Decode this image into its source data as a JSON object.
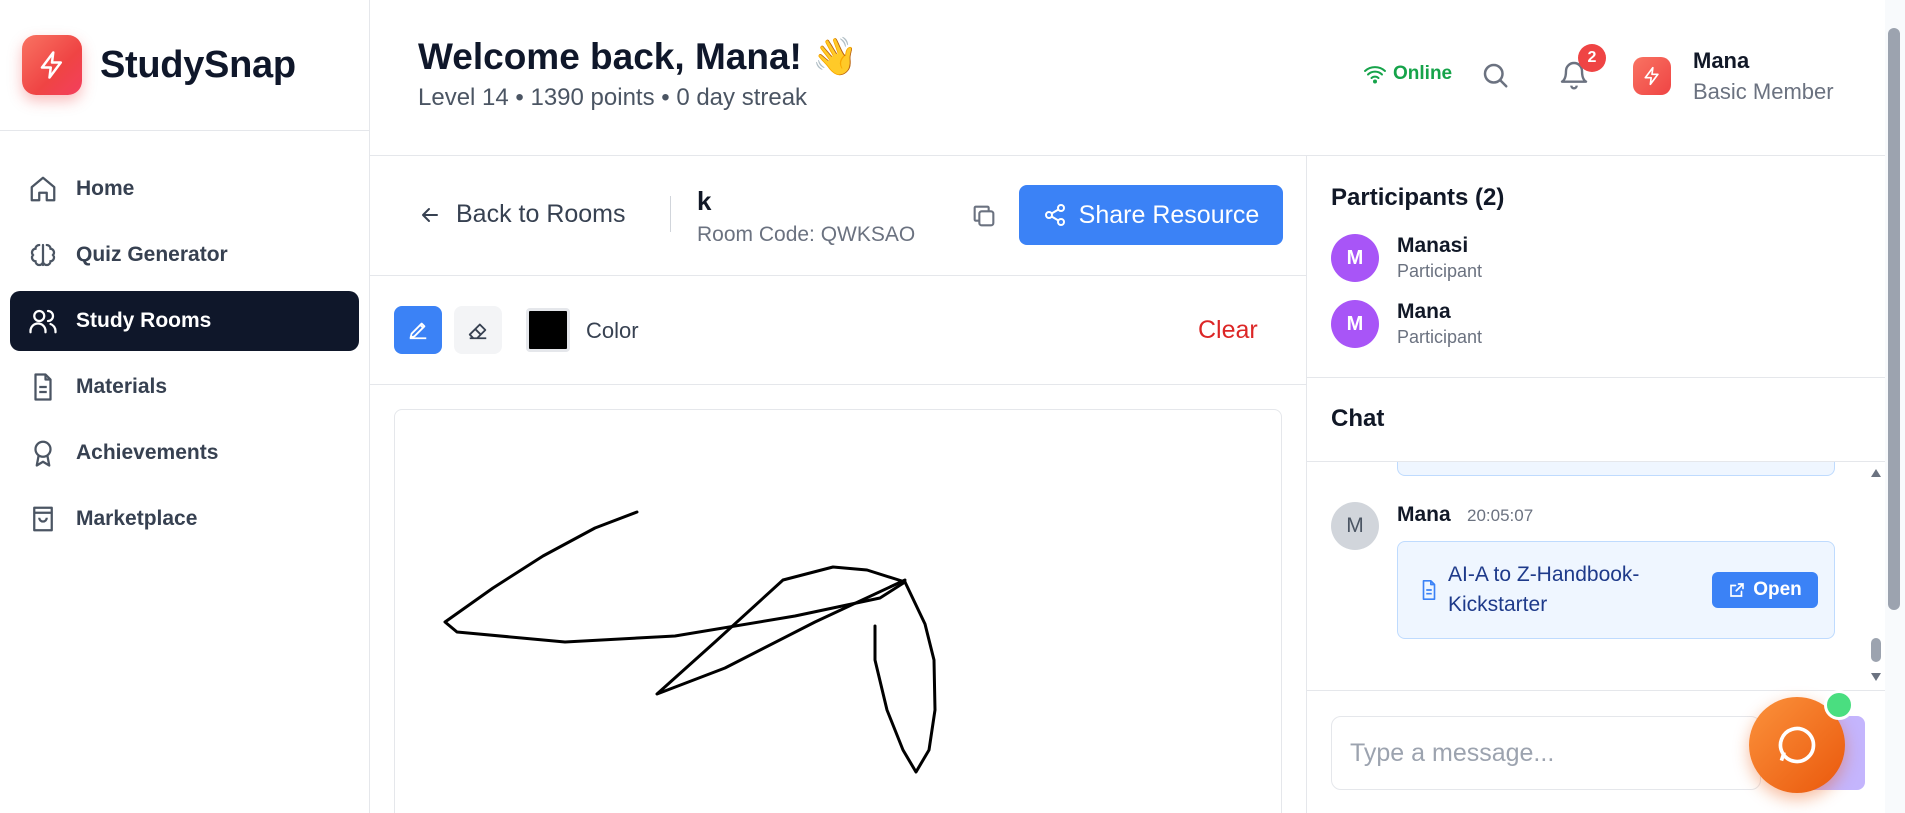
{
  "brand": {
    "name": "StudySnap",
    "logo_icon": "lightning-icon"
  },
  "sidebar": {
    "items": [
      {
        "label": "Home",
        "icon": "home-icon",
        "active": false
      },
      {
        "label": "Quiz Generator",
        "icon": "brain-icon",
        "active": false
      },
      {
        "label": "Study Rooms",
        "icon": "users-icon",
        "active": true
      },
      {
        "label": "Materials",
        "icon": "document-icon",
        "active": false
      },
      {
        "label": "Achievements",
        "icon": "award-icon",
        "active": false
      },
      {
        "label": "Marketplace",
        "icon": "shopping-bag-icon",
        "active": false
      }
    ]
  },
  "header": {
    "welcome": "Welcome back, Mana! 👋",
    "stats": "Level 14 • 1390 points • 0 day streak",
    "status": "Online",
    "notification_count": "2",
    "user": {
      "name": "Mana",
      "tier": "Basic Member"
    }
  },
  "room": {
    "back_label": "Back to Rooms",
    "name": "k",
    "code": "Room Code: QWKSAO",
    "share_label": "Share Resource"
  },
  "toolbar": {
    "color_label": "Color",
    "current_color": "#000000",
    "clear_label": "Clear"
  },
  "participants": {
    "title": "Participants (2)",
    "list": [
      {
        "initial": "M",
        "name": "Manasi",
        "role": "Participant"
      },
      {
        "initial": "M",
        "name": "Mana",
        "role": "Participant"
      }
    ]
  },
  "chat": {
    "title": "Chat",
    "messages": [
      {
        "initial": "M",
        "sender": "Mana",
        "time": "20:05:07",
        "file": "AI-A to Z-Handbook-Kickstarter",
        "open_label": "Open"
      }
    ],
    "input_placeholder": "Type a message..."
  },
  "colors": {
    "accent": "#3b82f6",
    "sidebar_active": "#0f172a",
    "online": "#16a34a",
    "danger": "#dc2626",
    "participant_avatar": "#a855f7"
  }
}
